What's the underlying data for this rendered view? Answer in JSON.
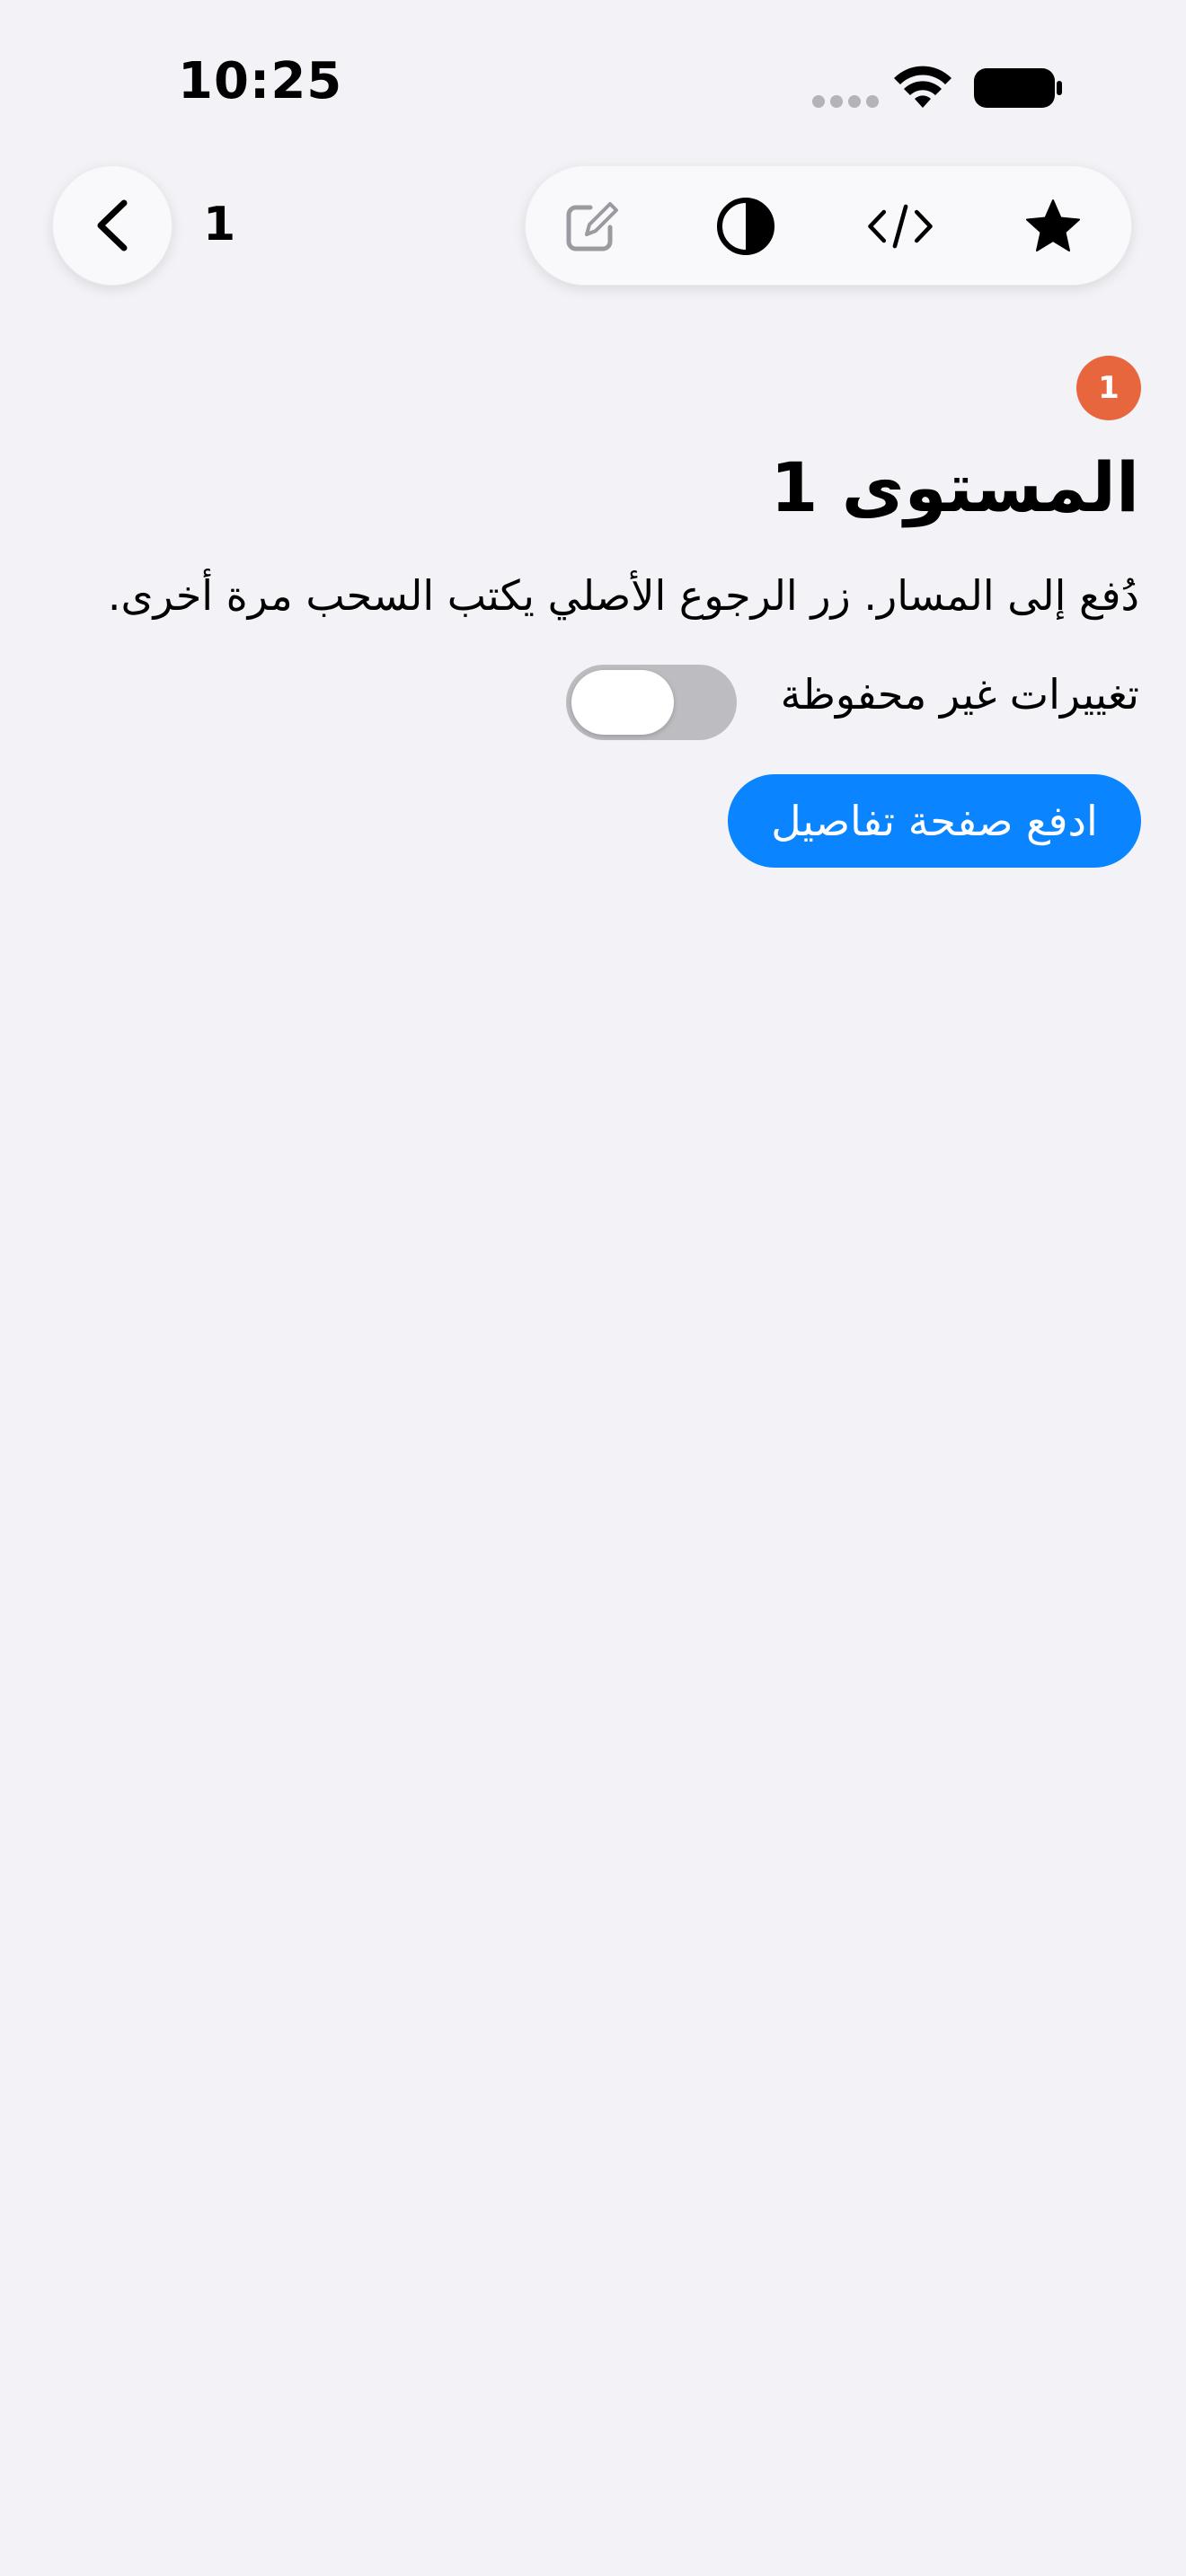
{
  "status_bar": {
    "time": "10:25"
  },
  "nav": {
    "title": "1",
    "back_icon": "chevron-left-icon"
  },
  "toolbar": {
    "items": [
      {
        "name": "compose-icon",
        "state": "disabled"
      },
      {
        "name": "contrast-icon"
      },
      {
        "name": "code-icon"
      },
      {
        "name": "star-icon"
      }
    ]
  },
  "content": {
    "badge": "1",
    "title": "المستوى 1",
    "description": "دُفع إلى المسار. زر الرجوع الأصلي يكتب السحب مرة أخرى.",
    "toggle_label": "تغييرات غير محفوظة",
    "toggle_on": false,
    "push_button_label": "ادفع صفحة تفاصيل"
  },
  "colors": {
    "background": "#f2f2f7",
    "accent": "#0a84ff",
    "badge": "#e8663d",
    "toggle_off": "#bcbcc1"
  }
}
